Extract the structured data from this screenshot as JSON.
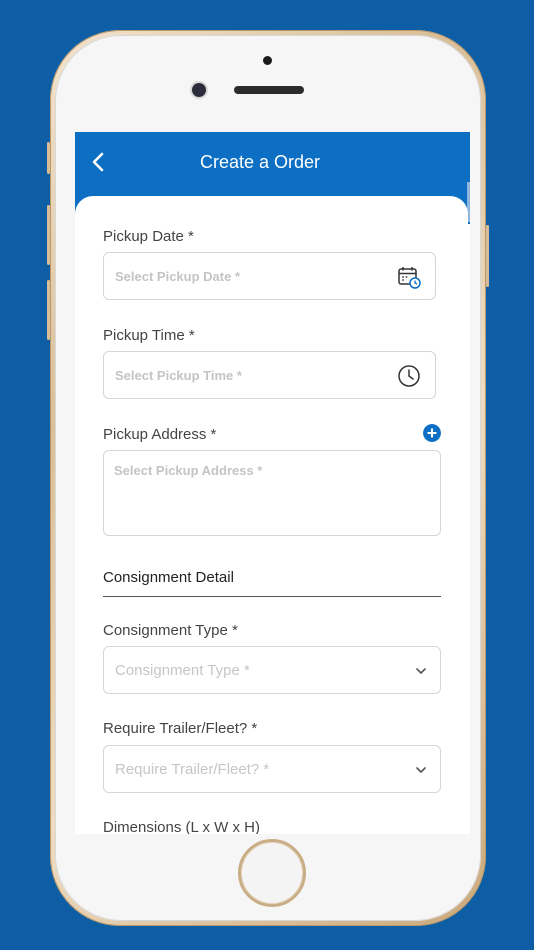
{
  "header": {
    "title": "Create a Order"
  },
  "form": {
    "pickup_date": {
      "label": "Pickup Date *",
      "placeholder": "Select Pickup Date *"
    },
    "pickup_time": {
      "label": "Pickup Time *",
      "placeholder": "Select Pickup Time *"
    },
    "pickup_address": {
      "label": "Pickup Address *",
      "placeholder": "Select Pickup Address *"
    },
    "consignment_section": "Consignment Detail",
    "consignment_type": {
      "label": "Consignment Type *",
      "placeholder": "Consignment Type *"
    },
    "trailer": {
      "label": "Require Trailer/Fleet? *",
      "placeholder": "Require Trailer/Fleet? *"
    },
    "dimensions": {
      "label": "Dimensions (L x W x H)"
    }
  },
  "icons": {
    "back": "chevron-left-icon",
    "date": "calendar-icon",
    "time": "clock-icon",
    "add": "plus-circle-icon",
    "dropdown": "chevron-down-icon"
  },
  "colors": {
    "brand": "#0d6fc3",
    "background": "#0d5ea4"
  }
}
